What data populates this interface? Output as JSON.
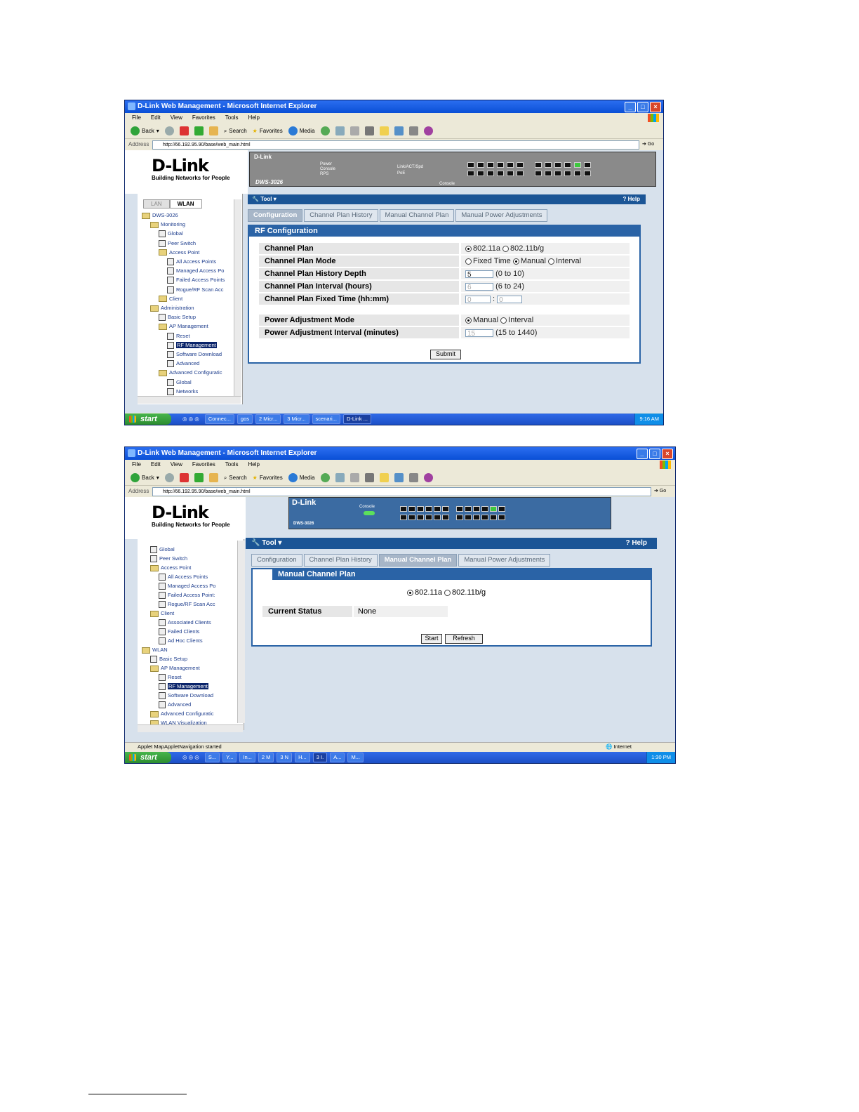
{
  "window1": {
    "title": "D-Link Web Management - Microsoft Internet Explorer",
    "menu": [
      "File",
      "Edit",
      "View",
      "Favorites",
      "Tools",
      "Help"
    ],
    "toolbar": {
      "back": "Back",
      "search": "Search",
      "favorites": "Favorites",
      "media": "Media"
    },
    "address_label": "Address",
    "url": "http://66.192.95.90/base/web_main.html",
    "go": "Go",
    "logo": {
      "name": "D-Link",
      "tagline": "Building Networks for People"
    },
    "device": {
      "brand": "D-Link",
      "model": "DWS-3026",
      "leds": [
        "Power",
        "Console",
        "RPS"
      ],
      "labels": [
        "Link/ACT/Spd",
        "PoE",
        "Console"
      ]
    },
    "nav_tabs": [
      "LAN",
      "WLAN"
    ],
    "nav_items": [
      "DWS-3026",
      "Monitoring",
      "Global",
      "Peer Switch",
      "Access Point",
      "All Access Points",
      "Managed Access Po",
      "Failed Access Points",
      "Rogue/RF Scan Acc",
      "Client",
      "Administration",
      "Basic Setup",
      "AP Management",
      "Reset",
      "RF Management",
      "Software Download",
      "Advanced",
      "Advanced Configuratic",
      "Global",
      "Networks"
    ],
    "tool_label": "Tool",
    "help_label": "Help",
    "tabs": [
      "Configuration",
      "Channel Plan History",
      "Manual Channel Plan",
      "Manual Power Adjustments"
    ],
    "panel_title": "RF Configuration",
    "rows": {
      "channel_plan": {
        "label": "Channel Plan",
        "opt1": "802.11a",
        "opt2": "802.11b/g"
      },
      "channel_plan_mode": {
        "label": "Channel Plan Mode",
        "opt1": "Fixed Time",
        "opt2": "Manual",
        "opt3": "Interval"
      },
      "history_depth": {
        "label": "Channel Plan History Depth",
        "value": "5",
        "range": "(0 to 10)"
      },
      "interval": {
        "label": "Channel Plan Interval (hours)",
        "value": "6",
        "range": "(6 to 24)"
      },
      "fixed_time": {
        "label": "Channel Plan Fixed Time (hh:mm)",
        "hh": "0",
        "mm": "0"
      },
      "power_mode": {
        "label": "Power Adjustment Mode",
        "opt1": "Manual",
        "opt2": "Interval"
      },
      "power_interval": {
        "label": "Power Adjustment Interval (minutes)",
        "value": "15",
        "range": "(15 to 1440)"
      }
    },
    "submit": "Submit",
    "taskbar": {
      "start": "start",
      "tasks": [
        "Connec...",
        "gos",
        "2 Micr...",
        "3 Micr...",
        "scenari...",
        "D-Link ..."
      ],
      "clock": "9:16 AM"
    }
  },
  "window2": {
    "title": "D-Link Web Management - Microsoft Internet Explorer",
    "menu": [
      "File",
      "Edit",
      "View",
      "Favorites",
      "Tools",
      "Help"
    ],
    "toolbar": {
      "back": "Back",
      "search": "Search",
      "favorites": "Favorites",
      "media": "Media"
    },
    "address_label": "Address",
    "url": "http://66.192.95.90/base/web_main.html",
    "go": "Go",
    "logo": {
      "name": "D-Link",
      "tagline": "Building Networks for People"
    },
    "device": {
      "brand": "D-Link",
      "model": "DWS-3026",
      "console": "Console"
    },
    "nav_items": [
      "Global",
      "Peer Switch",
      "Access Point",
      "All Access Points",
      "Managed Access Po",
      "Failed Access Point:",
      "Rogue/RF Scan Acc",
      "Client",
      "Associated Clients",
      "Failed Clients",
      "Ad Hoc Clients",
      "WLAN",
      "Basic Setup",
      "AP Management",
      "Reset",
      "RF Management",
      "Software Download",
      "Advanced",
      "Advanced Configuratic",
      "WLAN Visualization"
    ],
    "tool_label": "Tool",
    "help_label": "Help",
    "tabs": [
      "Configuration",
      "Channel Plan History",
      "Manual Channel Plan",
      "Manual Power Adjustments"
    ],
    "panel_title": "Manual Channel Plan",
    "radio1": "802.11a",
    "radio2": "802.11b/g",
    "status_label": "Current Status",
    "status_value": "None",
    "start": "Start",
    "refresh": "Refresh",
    "statusbar": "Applet MapAppletNavigation started",
    "zone": "Internet",
    "taskbar": {
      "start": "start",
      "tasks": [
        "S...",
        "Y...",
        "In...",
        "2 M",
        "3 N",
        "H...",
        "3 I.",
        "A...",
        "M..."
      ],
      "clock": "1:30 PM"
    }
  }
}
